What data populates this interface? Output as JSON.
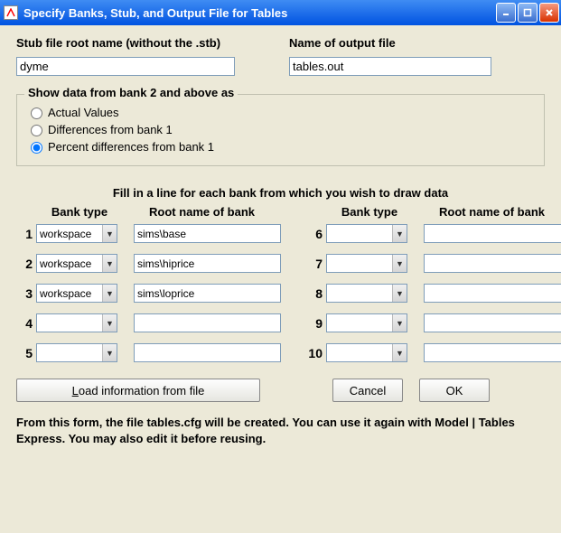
{
  "window": {
    "title": "Specify Banks, Stub, and Output File for Tables"
  },
  "labels": {
    "stub_root": "Stub file root name (without the .stb)",
    "output_file": "Name of output file",
    "show_legend": "Show data from bank 2 and above as",
    "radio_actual": "Actual Values",
    "radio_diff": "Differences from bank 1",
    "radio_pct": "Percent differences from bank 1",
    "fill_line": "Fill in a line for each bank from which you wish to draw data",
    "bank_type": "Bank type",
    "root_name": "Root name of bank",
    "load_btn_pre": "L",
    "load_btn_rest": "oad information from file",
    "cancel": "Cancel",
    "ok": "OK",
    "footer": "From this form, the file tables.cfg will be created.  You can use it again with Model | Tables Express.  You may also edit it before reusing."
  },
  "values": {
    "stub_root": "dyme",
    "output_file": "tables.out",
    "show_mode": "pct"
  },
  "banks": [
    {
      "n": "1",
      "type": "workspace",
      "root": "sims\\base"
    },
    {
      "n": "2",
      "type": "workspace",
      "root": "sims\\hiprice"
    },
    {
      "n": "3",
      "type": "workspace",
      "root": "sims\\loprice"
    },
    {
      "n": "4",
      "type": "",
      "root": ""
    },
    {
      "n": "5",
      "type": "",
      "root": ""
    },
    {
      "n": "6",
      "type": "",
      "root": ""
    },
    {
      "n": "7",
      "type": "",
      "root": ""
    },
    {
      "n": "8",
      "type": "",
      "root": ""
    },
    {
      "n": "9",
      "type": "",
      "root": ""
    },
    {
      "n": "10",
      "type": "",
      "root": ""
    }
  ]
}
